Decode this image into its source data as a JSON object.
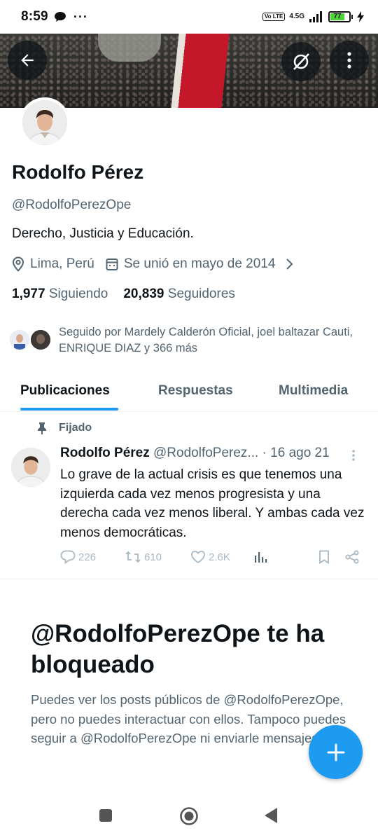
{
  "status_bar": {
    "time": "8:59",
    "dots": "···",
    "volte_label": "Vo LTE",
    "network_label": "4.5G",
    "battery_level": "77",
    "battery_fraction": 0.77
  },
  "profile": {
    "name": "Rodolfo Pérez",
    "handle": "@RodolfoPerezOpe",
    "bio": "Derecho, Justicia y Educación.",
    "location": "Lima, Perú",
    "joined": "Se unió en mayo de 2014",
    "following_count": "1,977",
    "following_label": "Siguiendo",
    "followers_count": "20,839",
    "followers_label": "Seguidores",
    "followed_by": "Seguido por Mardely Calderón Oficial, joel baltazar Cauti, ENRIQUE DIAZ y 366 más"
  },
  "tabs": [
    {
      "label": "Publicaciones",
      "active": true
    },
    {
      "label": "Respuestas",
      "active": false
    },
    {
      "label": "Multimedia",
      "active": false
    }
  ],
  "pinned_tweet": {
    "pinned_label": "Fijado",
    "author_name": "Rodolfo Pérez",
    "author_handle": "@RodolfoPerez...",
    "separator": "·",
    "date": "16 ago 21",
    "text": "Lo grave de la actual crisis es que tenemos una izquierda cada vez menos progresista y una derecha cada vez menos liberal. Y ambas cada vez menos democráticas.",
    "replies": "226",
    "retweets": "610",
    "likes": "2.6K"
  },
  "blocked": {
    "title": "@RodolfoPerezOpe te ha bloqueado",
    "description": "Puedes ver los posts públicos de @RodolfoPerezOpe, pero no puedes interactuar con ellos. Tampoco puedes seguir a @RodolfoPerezOpe ni enviarle mensajes."
  },
  "colors": {
    "accent": "#1d9bf0",
    "text": "#0f1419",
    "secondary": "#536471"
  },
  "icons": [
    "chat-icon",
    "back-arrow-icon",
    "grok-icon",
    "more-vertical-icon",
    "location-icon",
    "calendar-icon",
    "chevron-right-icon",
    "pin-icon",
    "reply-icon",
    "retweet-icon",
    "like-icon",
    "views-icon",
    "bookmark-icon",
    "share-icon",
    "compose-plus-icon"
  ]
}
